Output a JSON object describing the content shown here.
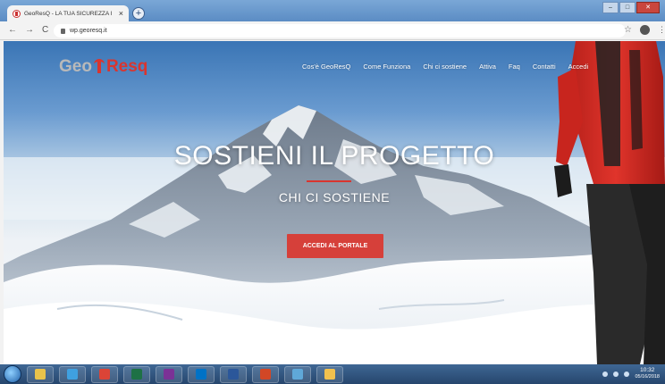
{
  "browser": {
    "tab_title": "GeoResQ - LA TUA SICUREZZA I",
    "tab_close": "×",
    "new_tab": "+",
    "address": "wp.georesq.it",
    "nav": {
      "back": "←",
      "forward": "→",
      "reload": "C"
    },
    "star": "☆",
    "menu": "⋮",
    "window_buttons": [
      "–",
      "□",
      "✕"
    ]
  },
  "site": {
    "logo": {
      "left": "Geo",
      "right": "Resq"
    },
    "nav_items": [
      "Cos'è GeoResQ",
      "Come Funziona",
      "Chi ci sostiene",
      "Attiva",
      "Faq",
      "Contatti",
      "Accedi"
    ],
    "hero_title": "SOSTIENI IL PROGETTO",
    "hero_subtitle": "CHI CI SOSTIENE",
    "cta_label": "ACCEDI AL PORTALE"
  },
  "colors": {
    "accent": "#d9352f",
    "logo_grey": "#b9b9b9",
    "taskbar": "#26466d"
  },
  "taskbar": {
    "apps": [
      {
        "name": "explorer-icon",
        "color": "#e8c24a"
      },
      {
        "name": "internet-explorer-icon",
        "color": "#3fa0e0"
      },
      {
        "name": "chrome-icon",
        "color": "#db4437"
      },
      {
        "name": "excel-icon",
        "color": "#1e7145"
      },
      {
        "name": "onenote-icon",
        "color": "#7b3296"
      },
      {
        "name": "outlook-icon",
        "color": "#0072c6"
      },
      {
        "name": "word-icon",
        "color": "#2b579a"
      },
      {
        "name": "powerpoint-icon",
        "color": "#d24726"
      },
      {
        "name": "window-icon",
        "color": "#5fa8d8"
      },
      {
        "name": "paint-icon",
        "color": "#f2c14e"
      }
    ],
    "clock_time": "10:32",
    "clock_date": "05/16/2018"
  }
}
